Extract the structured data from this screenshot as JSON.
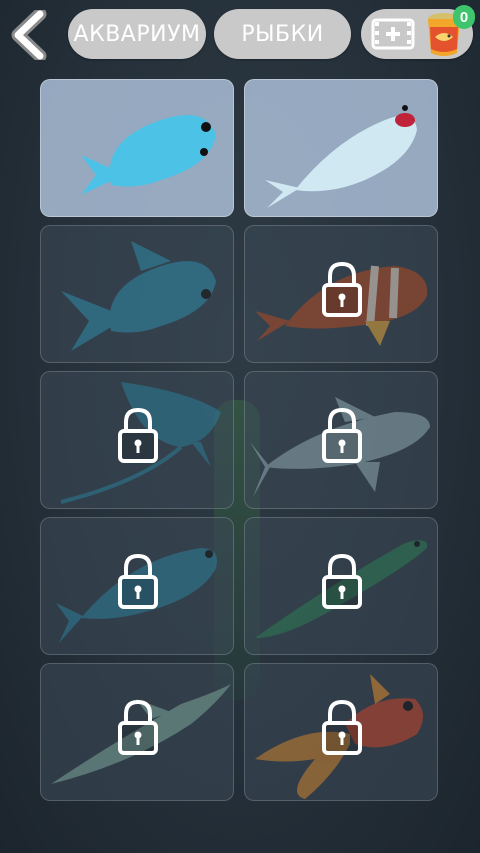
{
  "header": {
    "back_label": "back",
    "tab_aquarium": "АКВАРИУМ",
    "tab_fish": "РЫБКИ",
    "coin_count": "0"
  },
  "fish_grid": {
    "items": [
      {
        "name": "blue fish",
        "state": "unlocked",
        "color": "#4cc3e6"
      },
      {
        "name": "koi white",
        "state": "unlocked",
        "color": "#cfe8f2"
      },
      {
        "name": "blue fish dim",
        "state": "available",
        "color": "#2f8aa8"
      },
      {
        "name": "clown fish",
        "state": "locked",
        "color": "#b24a22"
      },
      {
        "name": "manta ray",
        "state": "locked",
        "color": "#2d7d97"
      },
      {
        "name": "shark",
        "state": "locked",
        "color": "#8fa8b0"
      },
      {
        "name": "tuna",
        "state": "locked",
        "color": "#2e7f9a"
      },
      {
        "name": "eel",
        "state": "locked",
        "color": "#2f7a55"
      },
      {
        "name": "swordfish",
        "state": "locked",
        "color": "#7da59a"
      },
      {
        "name": "goldfish",
        "state": "locked",
        "color": "#c8442a"
      }
    ]
  }
}
